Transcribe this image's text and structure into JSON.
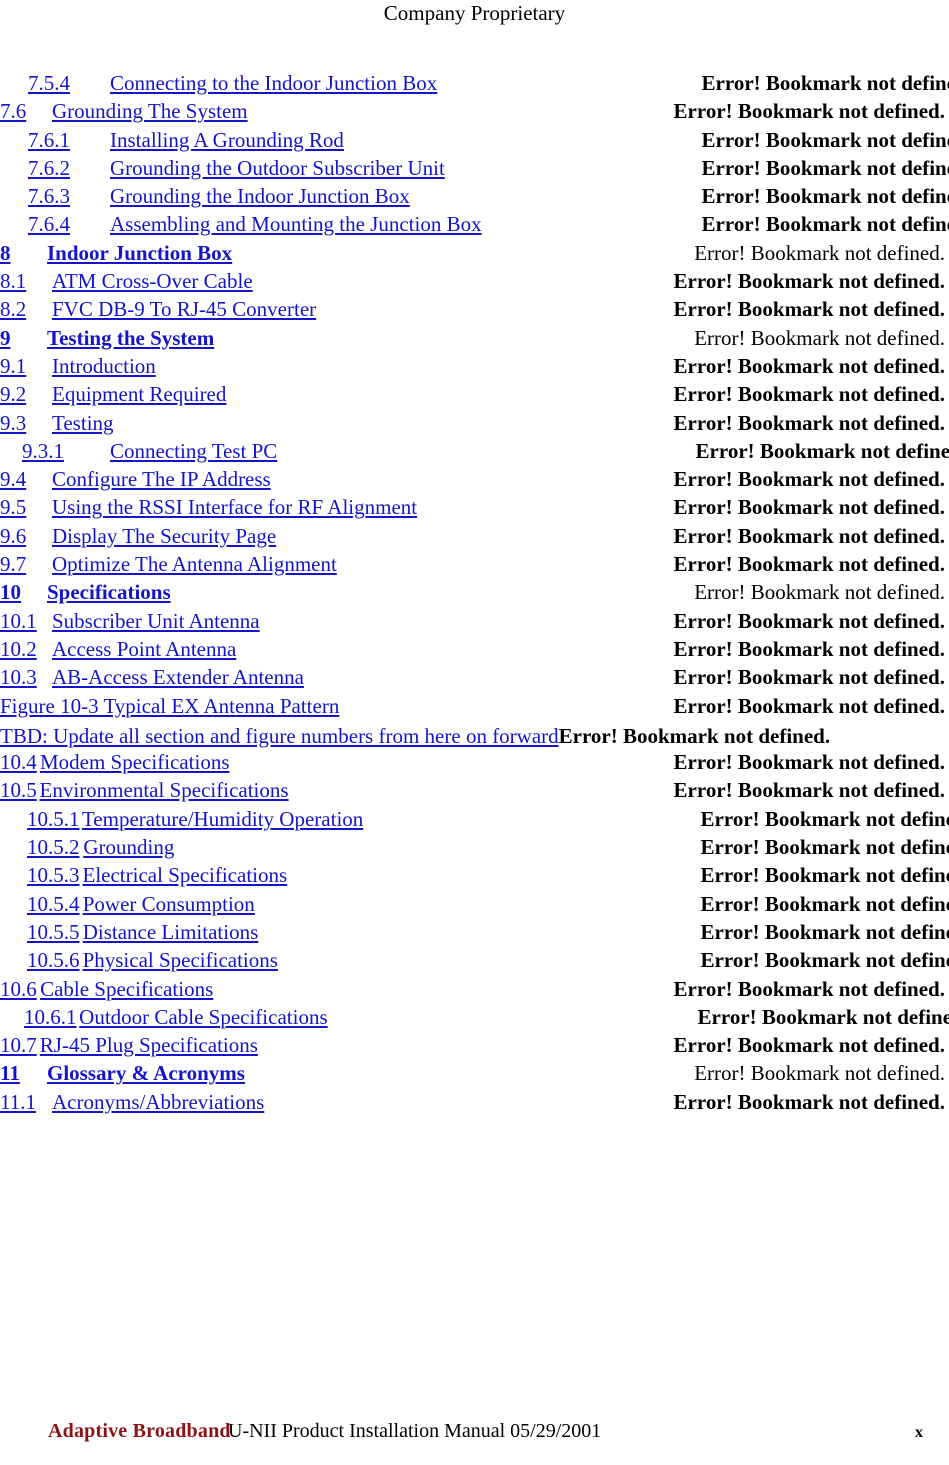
{
  "header": {
    "text": "Company Proprietary"
  },
  "pageref_text": "Error! Bookmark not defined.",
  "toc": {
    "entries": [
      {
        "level": 3,
        "number": "7.5.4",
        "title": "Connecting to the Indoor Junction Box",
        "pageref": "Error! Bookmark not defined."
      },
      {
        "level": 2,
        "number": "7.6",
        "title": "Grounding The System",
        "pageref": "Error! Bookmark not defined."
      },
      {
        "level": 3,
        "number": "7.6.1",
        "title": "Installing A Grounding Rod",
        "pageref": "Error! Bookmark not defined."
      },
      {
        "level": 3,
        "number": "7.6.2",
        "title": "Grounding the Outdoor Subscriber Unit",
        "pageref": "Error! Bookmark not defined."
      },
      {
        "level": 3,
        "number": "7.6.3",
        "title": "Grounding the Indoor Junction Box",
        "pageref": "Error! Bookmark not defined."
      },
      {
        "level": 3,
        "number": "7.6.4",
        "title": "Assembling and Mounting the Junction Box",
        "pageref": "Error! Bookmark not defined."
      },
      {
        "level": 1,
        "number": "8",
        "title": "Indoor Junction Box",
        "pageref": "Error! Bookmark not defined."
      },
      {
        "level": 2,
        "number": "8.1",
        "title": "ATM Cross-Over Cable",
        "pageref": "Error! Bookmark not defined."
      },
      {
        "level": 2,
        "number": "8.2",
        "title": "FVC DB-9 To RJ-45 Converter",
        "pageref": "Error! Bookmark not defined."
      },
      {
        "level": 1,
        "number": "9",
        "title": "Testing the System",
        "pageref": "Error! Bookmark not defined."
      },
      {
        "level": 2,
        "number": "9.1",
        "title": "Introduction",
        "pageref": "Error! Bookmark not defined."
      },
      {
        "level": 2,
        "number": "9.2",
        "title": "Equipment Required",
        "pageref": "Error! Bookmark not defined."
      },
      {
        "level": 2,
        "number": "9.3",
        "title": "Testing",
        "pageref": "Error! Bookmark not defined."
      },
      {
        "level": 3,
        "number": "9.3.1",
        "title": "Connecting Test PC",
        "pageref": "Error! Bookmark not defined."
      },
      {
        "level": 2,
        "number": "9.4",
        "title": "Configure The IP Address",
        "pageref": "Error! Bookmark not defined."
      },
      {
        "level": 2,
        "number": "9.5",
        "title": "Using the RSSI Interface for RF Alignment",
        "pageref": "Error! Bookmark not defined."
      },
      {
        "level": 2,
        "number": "9.6",
        "title": "Display The Security Page",
        "pageref": "Error! Bookmark not defined."
      },
      {
        "level": 2,
        "number": "9.7",
        "title": "Optimize The Antenna Alignment",
        "pageref": "Error! Bookmark not defined."
      },
      {
        "level": 1,
        "number": "10",
        "title": "Specifications",
        "pageref": "Error! Bookmark not defined."
      },
      {
        "level": 2,
        "number": "10.1",
        "title": "Subscriber Unit Antenna",
        "pageref": "Error! Bookmark not defined."
      },
      {
        "level": 2,
        "number": "10.2",
        "title": "Access Point Antenna",
        "pageref": "Error! Bookmark not defined."
      },
      {
        "level": 2,
        "number": "10.3",
        "title": "AB-Access Extender Antenna",
        "pageref": "Error! Bookmark not defined."
      },
      {
        "level": 0,
        "number": "",
        "title": "Figure 10-3 Typical EX Antenna Pattern",
        "pageref": "Error! Bookmark not defined."
      }
    ],
    "wrapped_entry": {
      "title": "TBD: Update all section and figure numbers from here on forward",
      "pageref": "Error! Bookmark not defined."
    },
    "entries_after_wrap": [
      {
        "level": 0,
        "number": "10.4",
        "title": "Modem Specifications",
        "pageref": "Error! Bookmark not defined."
      },
      {
        "level": 0,
        "number": "10.5",
        "title": "Environmental Specifications",
        "pageref": "Error! Bookmark not defined."
      },
      {
        "level": 0,
        "number": "10.5.1",
        "title": "Temperature/Humidity Operation",
        "pageref": "Error! Bookmark not defined."
      },
      {
        "level": 0,
        "number": "10.5.2",
        "title": "Grounding",
        "pageref": "Error! Bookmark not defined."
      },
      {
        "level": 0,
        "number": "10.5.3",
        "title": "Electrical Specifications",
        "pageref": "Error! Bookmark not defined."
      },
      {
        "level": 0,
        "number": "10.5.4",
        "title": "Power Consumption",
        "pageref": "Error! Bookmark not defined."
      },
      {
        "level": 0,
        "number": "10.5.5",
        "title": "Distance Limitations",
        "pageref": "Error! Bookmark not defined."
      },
      {
        "level": 0,
        "number": "10.5.6",
        "title": "Physical Specifications",
        "pageref": "Error! Bookmark not defined."
      },
      {
        "level": 0,
        "number": "10.6",
        "title": "Cable Specifications",
        "pageref": "Error! Bookmark not defined."
      },
      {
        "level": 0,
        "number": "10.6.1",
        "title": "Outdoor Cable Specifications",
        "pageref": "Error! Bookmark not defined."
      },
      {
        "level": 0,
        "number": "10.7",
        "title": "RJ-45 Plug Specifications",
        "pageref": "Error! Bookmark not defined."
      },
      {
        "level": 1,
        "number": "11",
        "title": "Glossary & Acronyms",
        "pageref": "Error! Bookmark not defined."
      },
      {
        "level": 2,
        "number": "11.1",
        "title": "Acronyms/Abbreviations",
        "pageref": "Error! Bookmark not defined."
      }
    ]
  },
  "footer": {
    "brand": "Adaptive Broadband",
    "title": "U-NII Product Installation Manual  05/29/2001",
    "page_number": "x"
  },
  "colors": {
    "link": "#1414c8",
    "brand": "#8b1318",
    "text": "#000000"
  }
}
